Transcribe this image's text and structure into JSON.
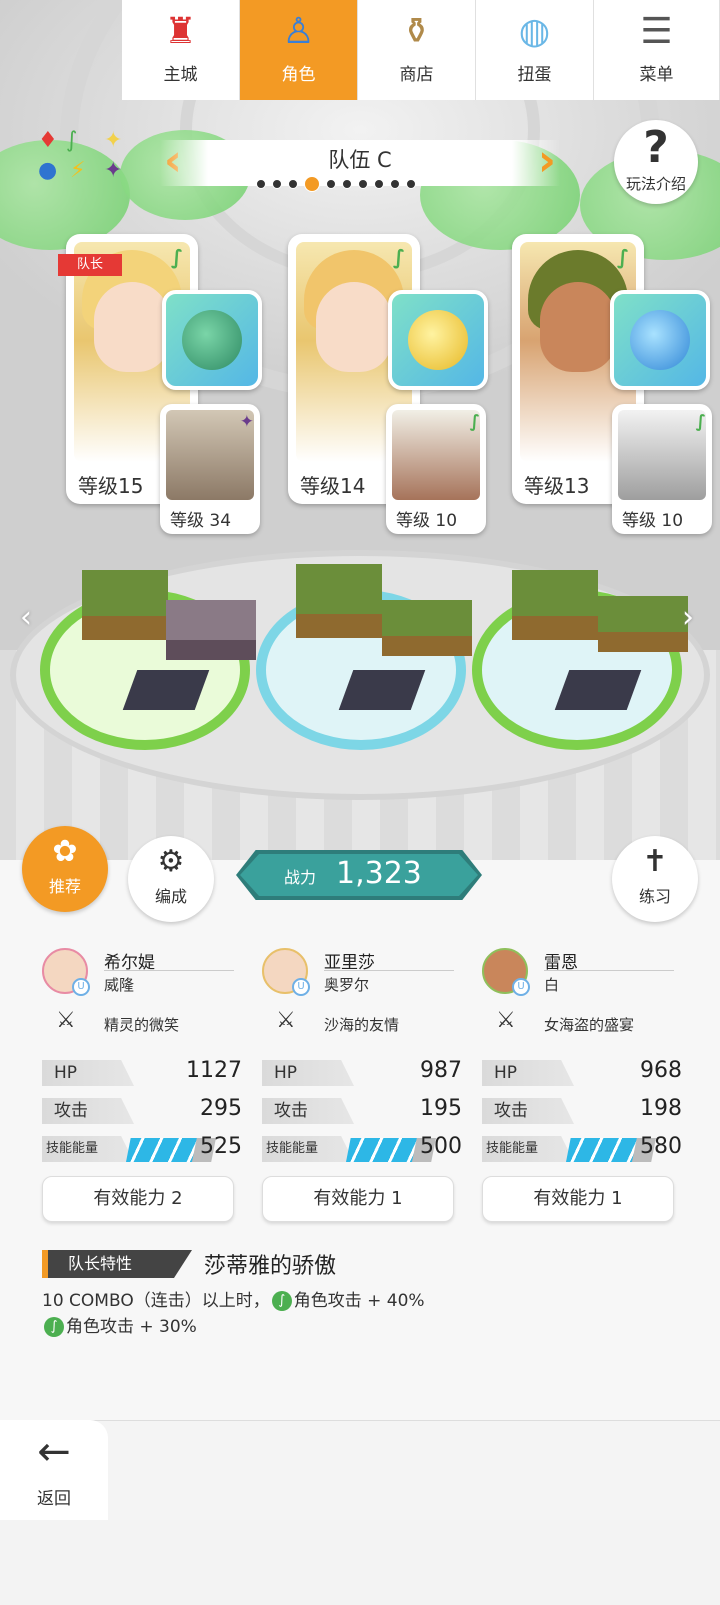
{
  "team": {
    "title": "队伍 C",
    "dots": 10,
    "active_dot": 3
  },
  "help": {
    "label": "玩法介绍",
    "icon": "question-icon"
  },
  "leader_tag": "队长",
  "characters": [
    {
      "name": "希尔媞",
      "sub_name": "威隆",
      "level": "等级15",
      "sub_level": "等级 34",
      "skill": "精灵的微笑",
      "hp_label": "HP",
      "hp": "1127",
      "atk_label": "攻击",
      "atk": "295",
      "energy_label": "技能能量",
      "energy": "525",
      "ability": "有效能力 2",
      "hair_color": "#f3d37a",
      "equip_color": "#3fa27c"
    },
    {
      "name": "亚里莎",
      "sub_name": "奥罗尔",
      "level": "等级14",
      "sub_level": "等级 10",
      "skill": "沙海的友情",
      "hp_label": "HP",
      "hp": "987",
      "atk_label": "攻击",
      "atk": "195",
      "energy_label": "技能能量",
      "energy": "500",
      "ability": "有效能力 1",
      "hair_color": "#f1c56b",
      "equip_color": "#f0c93b"
    },
    {
      "name": "雷恩",
      "sub_name": "白",
      "level": "等级13",
      "sub_level": "等级 10",
      "skill": "女海盗的盛宴",
      "hp_label": "HP",
      "hp": "968",
      "atk_label": "攻击",
      "atk": "198",
      "energy_label": "技能能量",
      "energy": "580",
      "ability": "有效能力 1",
      "hair_color": "#6b7b2c",
      "equip_color": "#3b8fd6"
    }
  ],
  "buttons": {
    "recommend": "推荐",
    "formation": "编成",
    "practice": "练习"
  },
  "power": {
    "label": "战力",
    "value": "1,323"
  },
  "leader_trait": {
    "tag": "队长特性",
    "title": "莎蒂雅的骄傲",
    "line1_a": "10 COMBO（连击）以上时，",
    "line1_b": "角色攻击 + 40%",
    "line2": "角色攻击 + 30%"
  },
  "nav": {
    "back": "返回",
    "items": [
      {
        "label": "主城",
        "icon": "castle-icon"
      },
      {
        "label": "角色",
        "icon": "character-icon",
        "active": true
      },
      {
        "label": "商店",
        "icon": "shop-icon"
      },
      {
        "label": "扭蛋",
        "icon": "gacha-icon"
      },
      {
        "label": "菜单",
        "icon": "menu-icon"
      }
    ]
  },
  "colors": {
    "accent": "#f39a24",
    "power": "#3aa19c",
    "energy": "#2db7e6",
    "element": "#4caf50"
  }
}
